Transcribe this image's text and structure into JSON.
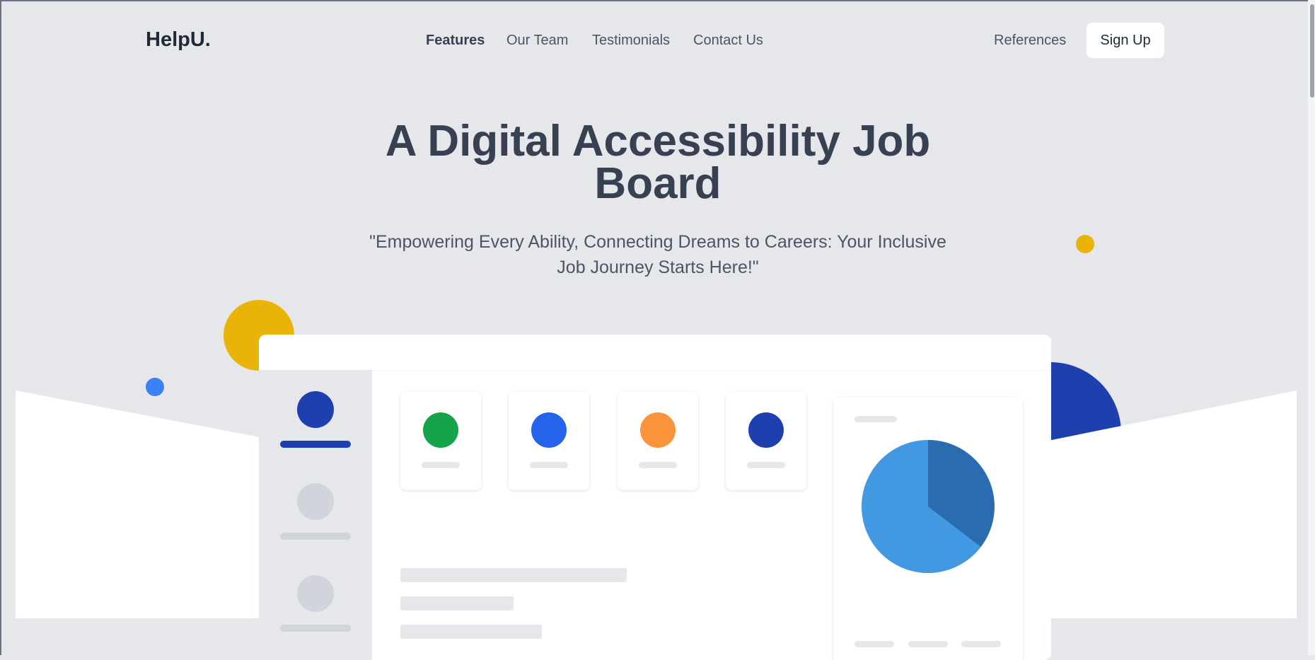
{
  "nav": {
    "logo": "HelpU.",
    "links": [
      {
        "label": "Features",
        "active": true
      },
      {
        "label": "Our Team",
        "active": false
      },
      {
        "label": "Testimonials",
        "active": false
      },
      {
        "label": "Contact Us",
        "active": false
      }
    ],
    "references": "References",
    "signup": "Sign Up"
  },
  "hero": {
    "title_line1": "A Digital Accessibility Job",
    "title_line2": "Board",
    "subtitle_line1": "\"Empowering Every Ability, Connecting Dreams to Careers: Your Inclusive",
    "subtitle_line2": "Job Journey Starts Here!\""
  },
  "colors": {
    "background": "#e5e7eb",
    "yellow": "#eab308",
    "blue": "#3b82f6",
    "navy": "#1e40af",
    "green": "#16a34a",
    "royal": "#2563eb",
    "orange": "#fb923c",
    "pie_light": "#4299e1",
    "pie_dark": "#2b6cb0"
  },
  "dashboard": {
    "stat_cards": [
      {
        "icon": "green-circle-icon",
        "color": "#16a34a"
      },
      {
        "icon": "blue-circle-icon",
        "color": "#2563eb"
      },
      {
        "icon": "orange-circle-icon",
        "color": "#fb923c"
      },
      {
        "icon": "navy-circle-icon",
        "color": "#1e40af"
      }
    ],
    "pie": {
      "slices": [
        0.65,
        0.35
      ]
    }
  }
}
